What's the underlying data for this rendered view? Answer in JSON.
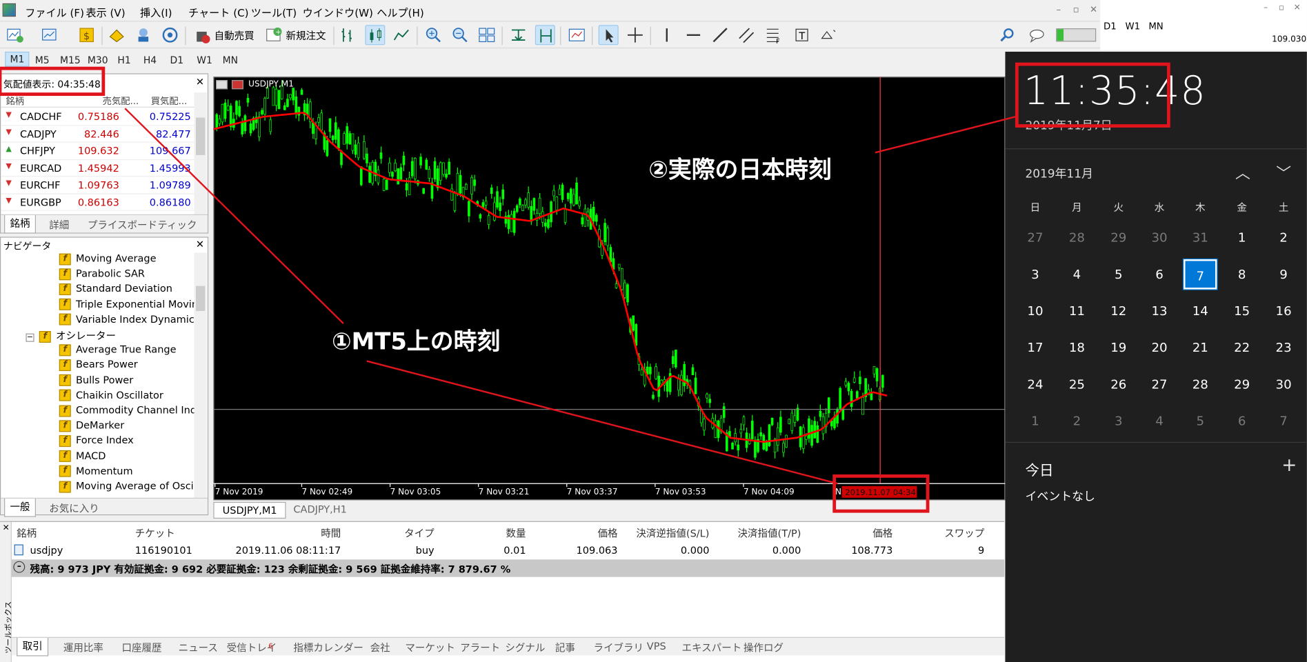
{
  "menu": [
    "ファイル (F)",
    "表示 (V)",
    "挿入(I)",
    "チャート (C)",
    "ツール(T)",
    "ウインドウ(W)",
    "ヘルプ(H)"
  ],
  "toolbar": {
    "auto_trade": "自動売買",
    "new_order": "新規注文"
  },
  "timeframes": [
    "M1",
    "M5",
    "M15",
    "M30",
    "H1",
    "H4",
    "D1",
    "W1",
    "MN"
  ],
  "right_timeframes": [
    "D1",
    "W1",
    "MN"
  ],
  "right_price": "109.030",
  "market_watch": {
    "title": "気配値表示: 04:35:48",
    "columns": [
      "銘柄",
      "売気配...",
      "買気配..."
    ],
    "rows": [
      {
        "symbol": "CADCHF",
        "bid": "0.75186",
        "ask": "0.75225",
        "dir": "down"
      },
      {
        "symbol": "CADJPY",
        "bid": "82.446",
        "ask": "82.477",
        "dir": "down"
      },
      {
        "symbol": "CHFJPY",
        "bid": "109.632",
        "ask": "109.667",
        "dir": "up"
      },
      {
        "symbol": "EURCAD",
        "bid": "1.45942",
        "ask": "1.45993",
        "dir": "down"
      },
      {
        "symbol": "EURCHF",
        "bid": "1.09763",
        "ask": "1.09789",
        "dir": "down"
      },
      {
        "symbol": "EURGBP",
        "bid": "0.86163",
        "ask": "0.86180",
        "dir": "down"
      }
    ],
    "tabs": [
      "銘柄",
      "詳細",
      "プライスボード",
      "ティック"
    ]
  },
  "navigator": {
    "title": "ナビゲータ",
    "trend_items": [
      "Moving Average",
      "Parabolic SAR",
      "Standard Deviation",
      "Triple Exponential Moving",
      "Variable Index Dynamic A"
    ],
    "oscillator_folder": "オシレーター",
    "oscillator_items": [
      "Average True Range",
      "Bears Power",
      "Bulls Power",
      "Chaikin Oscillator",
      "Commodity Channel Inde",
      "DeMarker",
      "Force Index",
      "MACD",
      "Momentum",
      "Moving Average of Oscill"
    ],
    "tabs": [
      "一般",
      "お気に入り"
    ]
  },
  "chart": {
    "title": "USDJPY,M1",
    "time_labels": [
      "7 Nov 2019",
      "7 Nov 02:49",
      "7 Nov 03:05",
      "7 Nov 03:21",
      "7 Nov 03:37",
      "7 Nov 03:53",
      "7 Nov 04:09"
    ],
    "time_label_partial": "N",
    "cursor_time": "2019.11.07 04:34",
    "tabs": [
      "USDJPY,M1",
      "CADJPY,H1"
    ]
  },
  "toolbox": {
    "side_label": "ツールボックス",
    "columns": [
      "銘柄",
      "チケット",
      "時間",
      "タイプ",
      "数量",
      "価格",
      "決済逆指値(S/L)",
      "決済指値(T/P)",
      "価格",
      "スワップ"
    ],
    "row": {
      "symbol": "usdjpy",
      "ticket": "116190101",
      "time": "2019.11.06 08:11:17",
      "type": "buy",
      "volume": "0.01",
      "price": "109.063",
      "sl": "0.000",
      "tp": "0.000",
      "current": "108.773",
      "swap": "9"
    },
    "balance": "残高: 9 973 JPY  有効証拠金: 9 692  必要証拠金: 123  余剰証拠金: 9 569  証拠金維持率: 7 879.67 %",
    "tabs": [
      "取引",
      "運用比率",
      "口座履歴",
      "ニュース",
      "受信トレイ",
      "指標カレンダー",
      "会社",
      "マーケット",
      "アラート",
      "シグナル",
      "記事",
      "ライブラリ",
      "VPS",
      "エキスパート",
      "操作ログ"
    ],
    "inbox_count": "6"
  },
  "calendar": {
    "time": "11:35:48",
    "date": "2019年11月7日",
    "month": "2019年11月",
    "weekdays": [
      "日",
      "月",
      "火",
      "水",
      "木",
      "金",
      "土"
    ],
    "days": [
      [
        "27",
        "28",
        "29",
        "30",
        "31",
        "1",
        "2"
      ],
      [
        "3",
        "4",
        "5",
        "6",
        "7",
        "8",
        "9"
      ],
      [
        "10",
        "11",
        "12",
        "13",
        "14",
        "15",
        "16"
      ],
      [
        "17",
        "18",
        "19",
        "20",
        "21",
        "22",
        "23"
      ],
      [
        "24",
        "25",
        "26",
        "27",
        "28",
        "29",
        "30"
      ],
      [
        "1",
        "2",
        "3",
        "4",
        "5",
        "6",
        "7"
      ]
    ],
    "today": "7",
    "today_label": "今日",
    "no_events": "イベントなし"
  },
  "annotations": {
    "mt5_time": "①MT5上の時刻",
    "japan_time": "②実際の日本時刻",
    "color": "#e0141c"
  },
  "colors": {
    "chart_bg": "#000000",
    "candle": "#00ff00",
    "ma": "#ff0000",
    "flyout_bg": "#1f1f1f",
    "today": "#0078d7"
  }
}
